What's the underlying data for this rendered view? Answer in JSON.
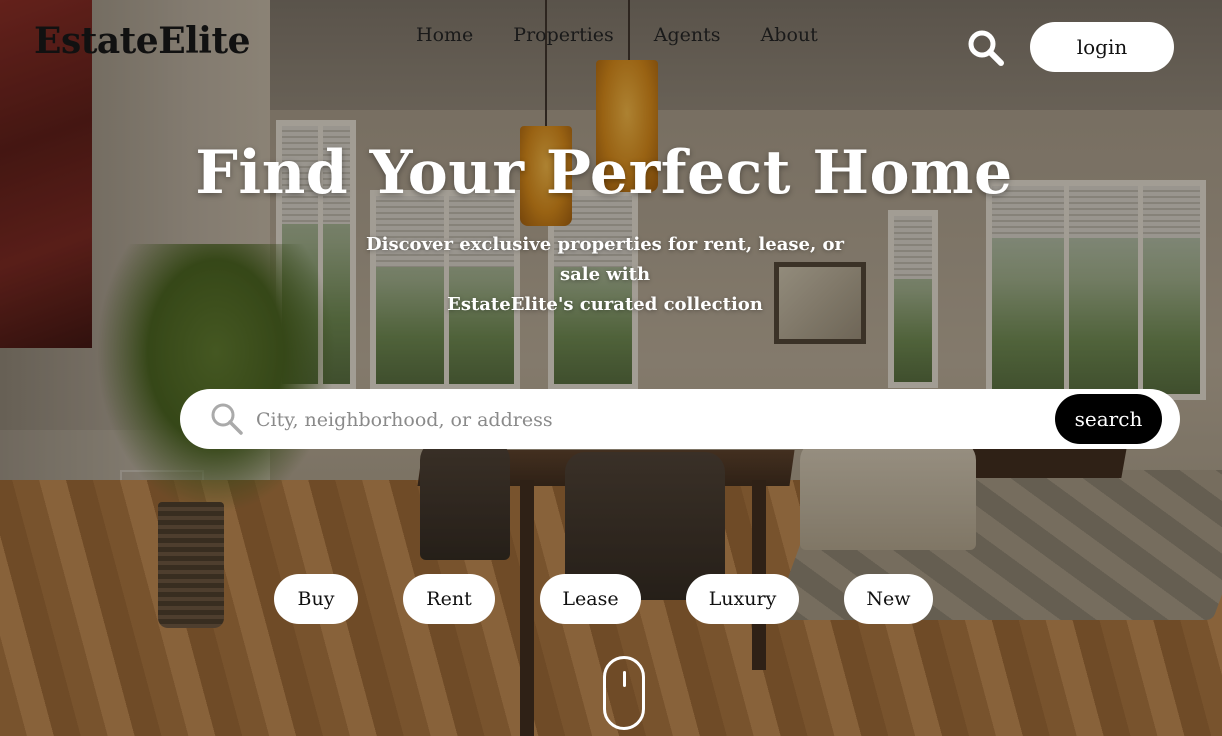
{
  "brand": {
    "name": "EstateElite"
  },
  "nav": {
    "links": [
      "Home",
      "Properties",
      "Agents",
      "About"
    ]
  },
  "header": {
    "search_icon": "search-icon",
    "login_label": "login"
  },
  "hero": {
    "title": "Find Your Perfect Home",
    "subtitle_line1": "Discover exclusive properties for rent, lease, or sale with",
    "subtitle_line2": "EstateElite's curated collection"
  },
  "search": {
    "placeholder": "City, neighborhood, or address",
    "value": "",
    "button_label": "search",
    "icon": "search-icon"
  },
  "filters": {
    "chips": [
      "Buy",
      "Rent",
      "Lease",
      "Luxury",
      "New"
    ]
  },
  "scroll_indicator": {
    "icon": "mouse-scroll-icon"
  },
  "colors": {
    "button_dark": "#000000",
    "button_light": "#ffffff",
    "brand_text": "#111111",
    "hero_text": "#ffffff"
  }
}
